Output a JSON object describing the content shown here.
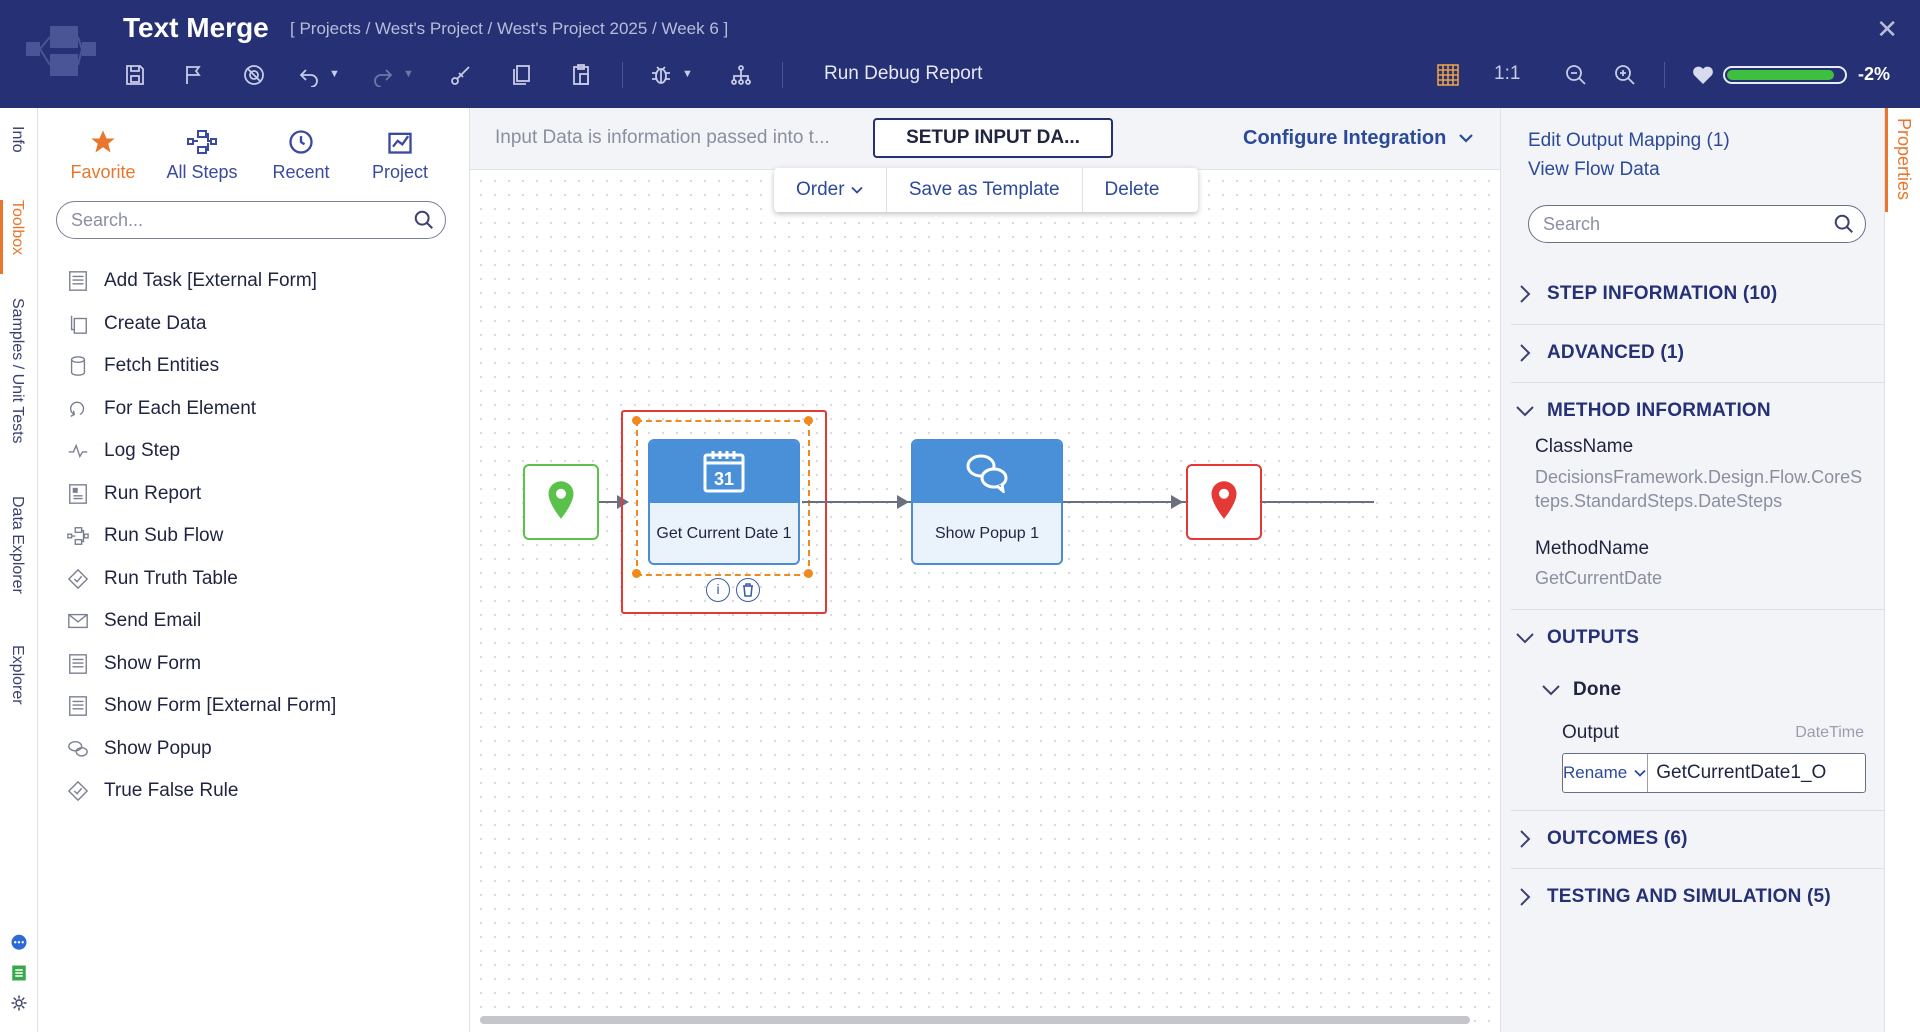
{
  "header": {
    "title": "Text Merge",
    "breadcrumb": "[ Projects / West's Project / West's Project 2025 / Week 6 ]",
    "run_debug_report": "Run Debug Report",
    "zoom_reset": "1:1",
    "health_percent_label": "-2%",
    "health_level": 0.92
  },
  "left_tabs": {
    "info": "Info",
    "toolbox": "Toolbox",
    "samples": "Samples / Unit Tests",
    "data_explorer": "Data Explorer",
    "explorer": "Explorer"
  },
  "toolbox": {
    "tabs": {
      "favorite": "Favorite",
      "all_steps": "All Steps",
      "recent": "Recent",
      "project": "Project"
    },
    "search_placeholder": "Search...",
    "items": [
      "Add Task [External Form]",
      "Create Data",
      "Fetch Entities",
      "For Each Element",
      "Log Step",
      "Run Report",
      "Run Sub Flow",
      "Run Truth Table",
      "Send Email",
      "Show Form",
      "Show Form [External Form]",
      "Show Popup",
      "True False Rule"
    ]
  },
  "canvas": {
    "info_text": "Input Data is information passed into t...",
    "setup_button": "SETUP INPUT DA...",
    "configure_integration": "Configure Integration",
    "actions": {
      "order": "Order",
      "save_template": "Save as Template",
      "delete": "Delete"
    },
    "steps": {
      "get_current_date": "Get Current Date 1",
      "calendar_day": "31",
      "show_popup": "Show Popup 1"
    },
    "colors": {
      "start": "#5ac24a",
      "end": "#e53935",
      "step": "#4a90d9",
      "selection": "#f08a1e"
    }
  },
  "properties": {
    "edit_output_mapping": "Edit Output Mapping (1)",
    "view_flow_data": "View Flow Data",
    "search_placeholder": "Search",
    "sections": {
      "step_information": "STEP INFORMATION (10)",
      "advanced": "ADVANCED (1)",
      "method_information": "METHOD INFORMATION",
      "outputs": "OUTPUTS",
      "outcomes": "OUTCOMES (6)",
      "testing": "TESTING AND SIMULATION (5)"
    },
    "class_name_label": "ClassName",
    "class_name_value": "DecisionsFramework.Design.Flow.CoreSteps.StandardSteps.DateSteps",
    "method_name_label": "MethodName",
    "method_name_value": "GetCurrentDate",
    "done_label": "Done",
    "output_label": "Output",
    "output_type": "DateTime",
    "rename_label": "Rename",
    "output_value": "GetCurrentDate1_O"
  },
  "right_tabs": {
    "properties": "Properties"
  }
}
